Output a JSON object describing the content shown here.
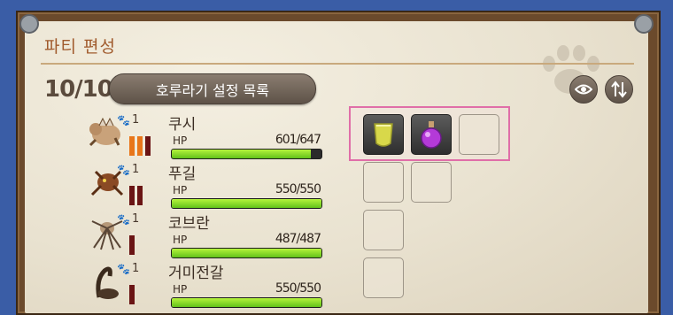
{
  "window": {
    "title": "파티 편성"
  },
  "party": {
    "count": "10/10",
    "macro_button": "호루라기 설정 목록"
  },
  "toolbar": {
    "view_icon": "eye-icon",
    "sort_icon": "sort-arrows-icon"
  },
  "members": [
    {
      "name": "쿠시",
      "rank": "1",
      "hp_label": "HP",
      "hp": "601/647",
      "hp_fraction": 0.929,
      "bars_color": "#e8761a",
      "bars": 3,
      "items": [
        "yellow-potion-icon",
        "purple-elixir-icon",
        ""
      ]
    },
    {
      "name": "푸길",
      "rank": "1",
      "hp_label": "HP",
      "hp": "550/550",
      "hp_fraction": 1.0,
      "bars_color": "#6a1414",
      "bars": 2,
      "items": [
        "",
        ""
      ]
    },
    {
      "name": "코브란",
      "rank": "1",
      "hp_label": "HP",
      "hp": "487/487",
      "hp_fraction": 1.0,
      "bars_color": "#6a1414",
      "bars": 1,
      "items": [
        ""
      ]
    },
    {
      "name": "거미전갈",
      "rank": "1",
      "hp_label": "HP",
      "hp": "550/550",
      "hp_fraction": 1.0,
      "bars_color": "#6a1414",
      "bars": 1,
      "items": [
        ""
      ]
    }
  ],
  "colors": {
    "highlight": "#e06ea8",
    "hp_fill": "#8ee02a"
  }
}
